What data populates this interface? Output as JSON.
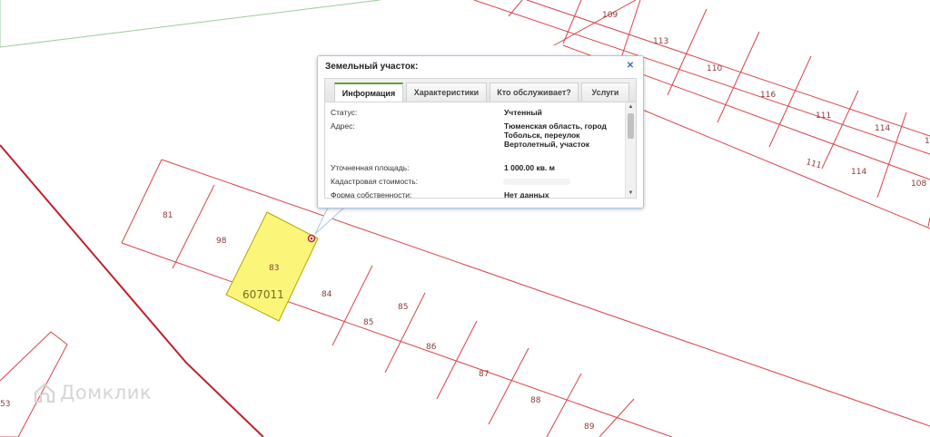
{
  "colors": {
    "plot_border": "#d9434a",
    "boundary": "#c0202a",
    "selected_fill": "#fbf67a",
    "selected_border": "#b3a400",
    "plot_label": "#8b3a3a",
    "block_border": "#9acb9a"
  },
  "map": {
    "block_label": "607011",
    "plots": [
      {
        "id": "109",
        "selected": false
      },
      {
        "id": "113",
        "selected": false
      },
      {
        "id": "110",
        "selected": false
      },
      {
        "id": "116",
        "selected": false
      },
      {
        "id": "111",
        "selected": false
      },
      {
        "id": "114",
        "selected": false
      },
      {
        "id": "111",
        "selected": false
      },
      {
        "id": "114",
        "selected": false
      },
      {
        "id": "108",
        "selected": false
      },
      {
        "id": "1",
        "selected": false
      },
      {
        "id": "81",
        "selected": false
      },
      {
        "id": "98",
        "selected": false
      },
      {
        "id": "83",
        "selected": true
      },
      {
        "id": "84",
        "selected": false
      },
      {
        "id": "85",
        "selected": false
      },
      {
        "id": "85",
        "selected": false
      },
      {
        "id": "86",
        "selected": false
      },
      {
        "id": "87",
        "selected": false
      },
      {
        "id": "88",
        "selected": false
      },
      {
        "id": "89",
        "selected": false
      },
      {
        "id": "53",
        "selected": false
      }
    ]
  },
  "watermark": {
    "text": "Домклик",
    "icon": "house-logo-icon"
  },
  "popup": {
    "title": "Земельный участок:",
    "close_icon": "close-icon",
    "tabs": [
      {
        "label": "Информация",
        "active": true
      },
      {
        "label": "Характеристики",
        "active": false
      },
      {
        "label": "Кто обслуживает?",
        "active": false
      },
      {
        "label": "Услуги",
        "active": false
      }
    ],
    "rows": [
      {
        "label": "Статус:",
        "value": "Учтенный"
      },
      {
        "label": "Адрес:",
        "value": "Тюменская область, город Тобольск, переулок Вертолетный, участок"
      },
      {
        "label": "Уточненная площадь:",
        "value": "1 000.00 кв. м"
      },
      {
        "label": "Кадастровая стоимость:",
        "value": ""
      },
      {
        "label": "Форма собственности:",
        "value": "Нет данных"
      }
    ]
  }
}
